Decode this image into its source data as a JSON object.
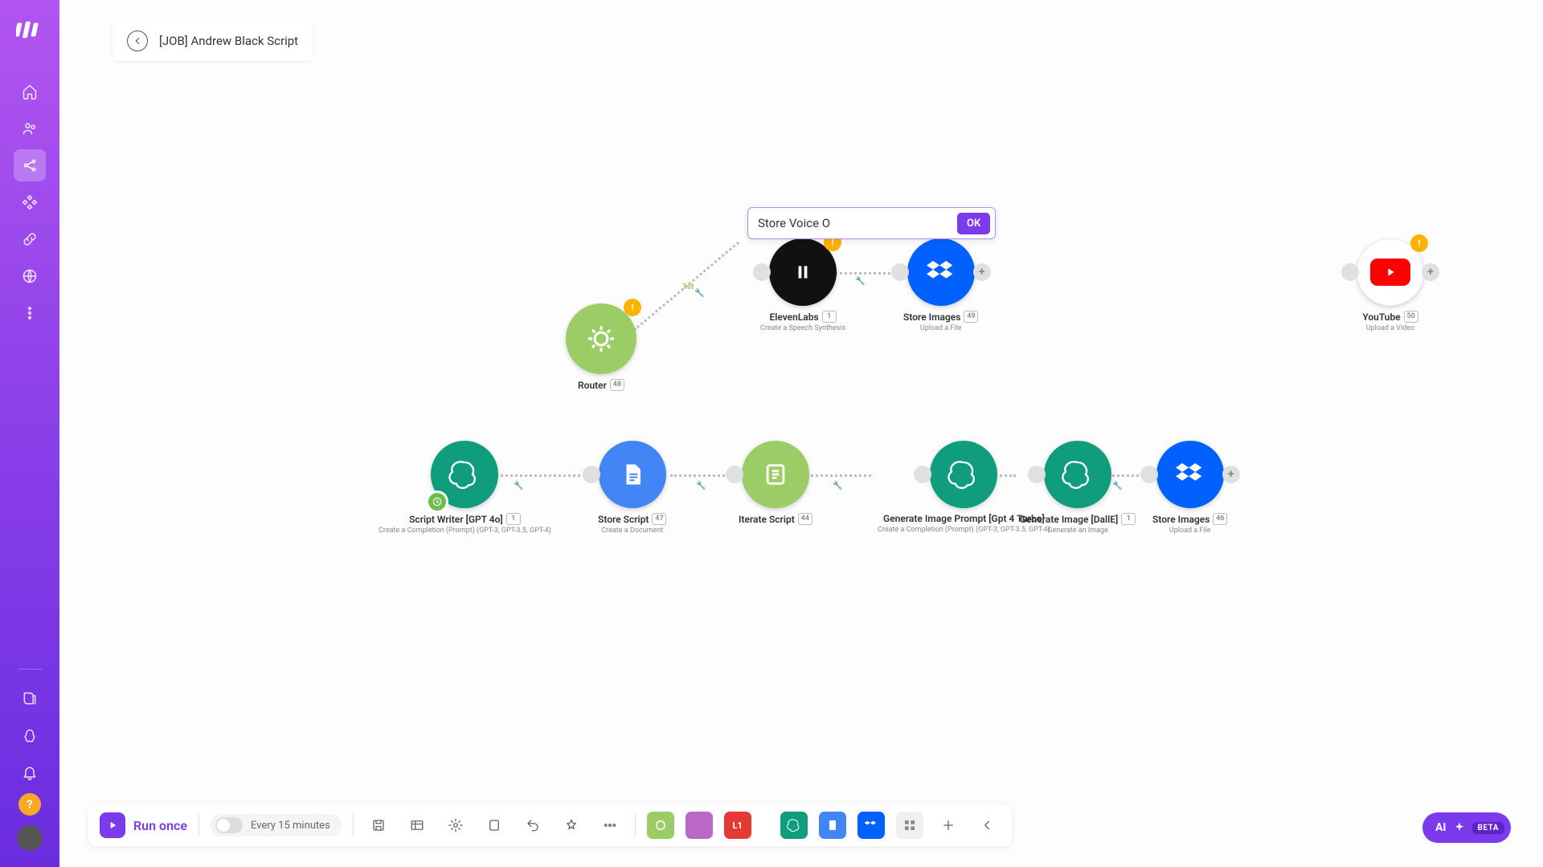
{
  "header": {
    "title": "[JOB] Andrew Black Script"
  },
  "rename": {
    "value": "Store Voice O",
    "ok": "OK"
  },
  "toolbar": {
    "run": "Run once",
    "schedule": "Every 15 minutes",
    "ai": "AI",
    "beta": "BETA",
    "l1": "L1"
  },
  "colors": {
    "accent": "#7c3aed",
    "dropbox": "#0061ff",
    "openai": "#0f9d7e",
    "router": "#9ccc65",
    "badge": "#ffb300"
  },
  "nodes": {
    "router": {
      "label": "Router",
      "tag": "48"
    },
    "eleven": {
      "label": "ElevenLabs",
      "tag": "1",
      "sub": "Create a Speech Synthesis"
    },
    "storeVoice": {
      "label": "Store Images",
      "tag": "49",
      "sub": "Upload a File"
    },
    "youtube": {
      "label": "YouTube",
      "tag": "50",
      "sub": "Upload a Video"
    },
    "scriptWriter": {
      "label": "Script Writer [GPT 4o]",
      "tag": "1",
      "sub": "Create a Completion (Prompt) (GPT-3, GPT-3.5, GPT-4)"
    },
    "storeScript": {
      "label": "Store Script",
      "tag": "47",
      "sub": "Create a Document"
    },
    "iterate": {
      "label": "Iterate Script",
      "tag": "44"
    },
    "genPrompt": {
      "label": "Generate Image Prompt [Gpt 4 Turbo]",
      "tag": "",
      "sub": "Create a Completion (Prompt) (GPT-3, GPT-3.5, GPT-4)"
    },
    "genImage": {
      "label": "Generate Image [DallE]",
      "tag": "1",
      "sub": "Generate an Image"
    },
    "storeImages": {
      "label": "Store Images",
      "tag": "46",
      "sub": "Upload a File"
    }
  },
  "edge_label": "1st"
}
